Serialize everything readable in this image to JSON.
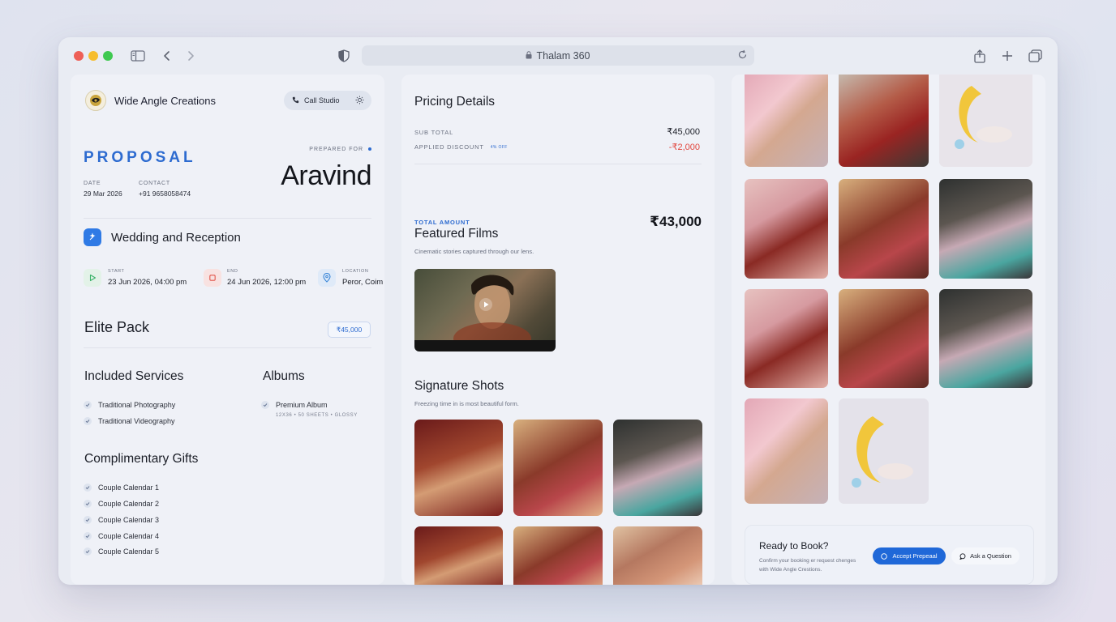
{
  "browser": {
    "url_title": "Thalam 360",
    "lights": {
      "close": "#ee5f56",
      "minimize": "#f6bd2e",
      "maximize": "#3fc950"
    }
  },
  "studio": {
    "name": "Wide Angle Creations",
    "call_label": "Call Studio"
  },
  "proposal": {
    "title": "PROPOSAL",
    "date_label": "DATE",
    "date_value": "29 Mar 2026",
    "contact_label": "CONTACT",
    "contact_value": "+91 9658058474",
    "prepared_label": "PREPARED FOR",
    "client": "Aravind"
  },
  "event": {
    "title": "Wedding and Reception",
    "start_label": "START",
    "start_value": "23 Jun 2026, 04:00 pm",
    "end_label": "END",
    "end_value": "24 Jun 2026, 12:00 pm",
    "location_label": "LOCATION",
    "location_value": "Peror, Coim"
  },
  "package": {
    "name": "Elite Pack",
    "price": "₹45,000"
  },
  "included": {
    "title": "Included Services",
    "items": [
      "Traditional Photography",
      "Traditional Videography"
    ]
  },
  "albums": {
    "title": "Albums",
    "items": [
      {
        "name": "Premium Album",
        "detail": "12X36 • 50 SHEETS • GLOSSY"
      }
    ]
  },
  "gifts": {
    "title": "Complimentary Gifts",
    "items": [
      "Couple Calendar 1",
      "Couple Calendar 2",
      "Couple Calendar 3",
      "Couple Calendar 4",
      "Couple Calendar 5"
    ]
  },
  "pricing": {
    "title": "Pricing Details",
    "subtotal_label": "SUB TOTAL",
    "subtotal_value": "₹45,000",
    "discount_label": "APPLIED DISCOUNT",
    "discount_chip": "4% OFF",
    "discount_value": "-₹2,000",
    "total_label": "TOTAL AMOUNT",
    "total_value": "₹43,000"
  },
  "films": {
    "title": "Featured Films",
    "subtitle": "Cinematic stories captured through our lens."
  },
  "shots": {
    "title": "Signature Shots",
    "subtitle": "Freezing time in is most beautiful form."
  },
  "cta": {
    "title": "Ready to Book?",
    "subtitle": "Confirm your booking er request chenges with Wide Angle Crestions.",
    "accept_label": "Accept Prepeaal",
    "ask_label": "Ask a Question"
  },
  "colors": {
    "accent": "#2d6bd0",
    "discount": "#e2453c",
    "start_icon": "#3bb26a",
    "end_icon": "#e2564c",
    "location_icon": "#3a86d8"
  }
}
